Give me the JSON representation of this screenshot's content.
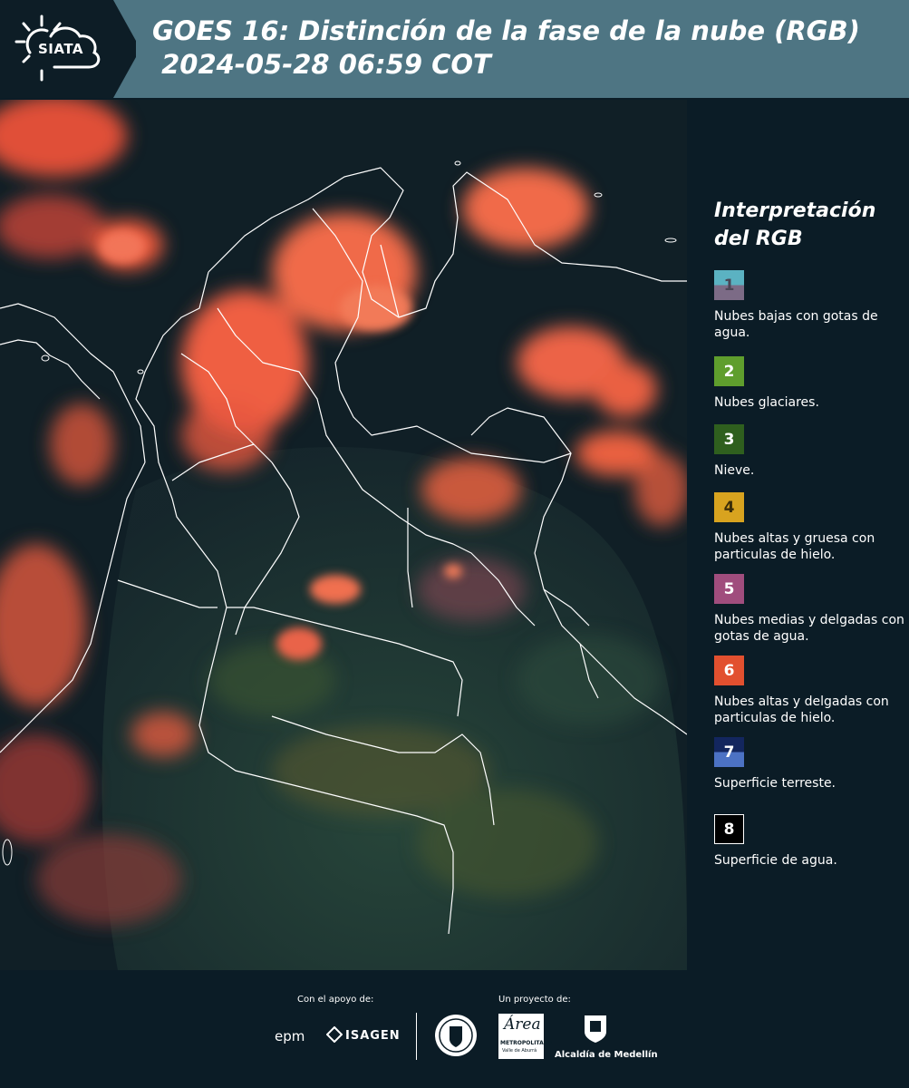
{
  "header": {
    "logo_text": "SIATA",
    "title_line1": "GOES 16: Distinción de la fase de la nube (RGB)",
    "title_line2": " 2024-05-28 06:59 COT"
  },
  "legend": {
    "title": "Interpretación del RGB",
    "items": [
      {
        "number": "1",
        "color_top": "#5bb2c2",
        "color_bottom": "#7c6b86",
        "text_color": "#4a4555",
        "desc": "Nubes bajas con gotas de agua."
      },
      {
        "number": "2",
        "color_top": "#5f9e2d",
        "color_bottom": "#5f9e2d",
        "text_color": "#ffffff",
        "desc": "Nubes glaciares."
      },
      {
        "number": "3",
        "color_top": "#2f5f1e",
        "color_bottom": "#2f5f1e",
        "text_color": "#ffffff",
        "desc": "Nieve."
      },
      {
        "number": "4",
        "color_top": "#d8a31f",
        "color_bottom": "#d8a31f",
        "text_color": "#3a2c08",
        "desc": "Nubes altas y gruesa con particulas de hielo."
      },
      {
        "number": "5",
        "color_top": "#a04d7d",
        "color_bottom": "#a04d7d",
        "text_color": "#ffffff",
        "desc": "Nubes medias y delgadas con gotas de agua."
      },
      {
        "number": "6",
        "color_top": "#e2502f",
        "color_bottom": "#e2502f",
        "text_color": "#ffffff",
        "desc": "Nubes altas y delgadas con particulas de hielo."
      },
      {
        "number": "7",
        "color_top": "#13265e",
        "color_bottom": "#4c72c4",
        "text_color": "#ffffff",
        "desc": "Superficie terreste."
      },
      {
        "number": "8",
        "color_top": "#000000",
        "color_bottom": "#000000",
        "text_color": "#ffffff",
        "desc": "Superficie de agua."
      }
    ]
  },
  "footer": {
    "support_label": "Con el apoyo de:",
    "project_label": "Un proyecto de:",
    "logo_epm": "epm",
    "logo_isagen": "ISAGEN",
    "logo_area_line1": "METROPOLITANA",
    "logo_area_line2": "Valle de Aburrá",
    "logo_area_script": "Área",
    "logo_alcaldia": "Alcaldía de Medellín"
  }
}
